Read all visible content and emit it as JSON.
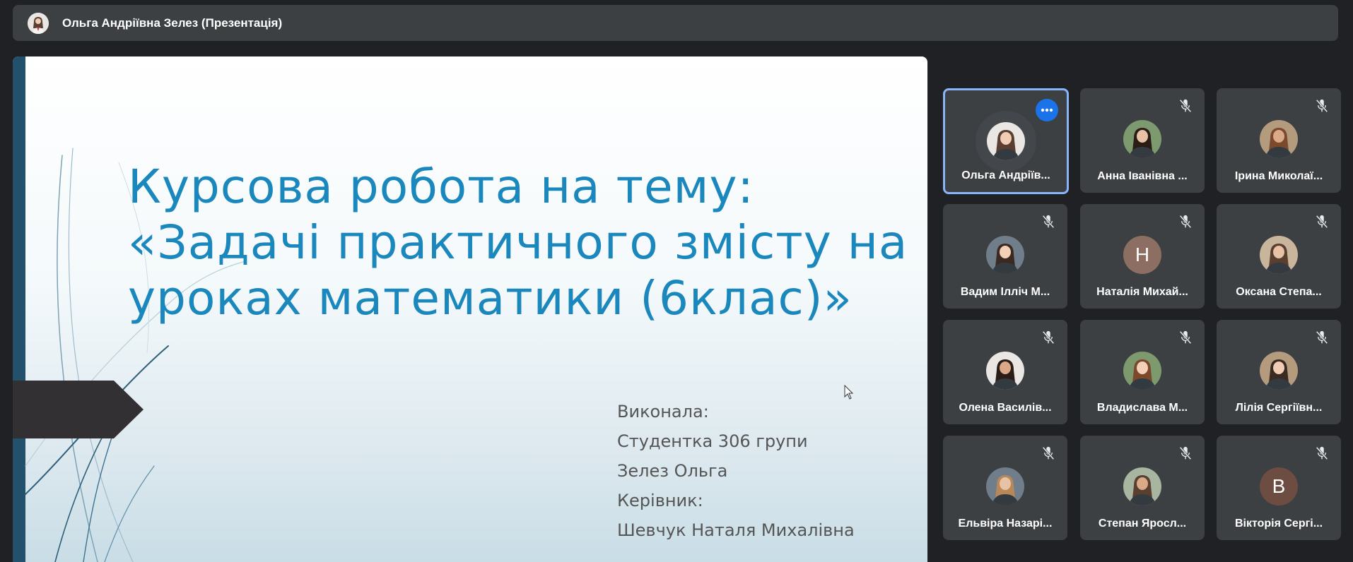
{
  "presenter_bar": {
    "title": "Ольга Андріївна Зелез (Презентація)",
    "avatar_icon": "user-avatar"
  },
  "slide": {
    "heading_lines": [
      "Курсова робота на тему:",
      "«Задачі практичного змісту на",
      "уроках математики (6клас)»"
    ],
    "author_lines": [
      "Виконала:",
      "Студентка 306 групи",
      "Зелез Ольга",
      "Керівник:",
      "Шевчук Наталя Михалівна"
    ],
    "accent_color": "#1a87bd"
  },
  "participants": [
    {
      "name": "Ольга Андріїв...",
      "avatar": "photo",
      "active": true,
      "muted": false,
      "icon": "more-options-icon"
    },
    {
      "name": "Анна Іванівна ...",
      "avatar": "photo",
      "muted": true,
      "icon": "mic-off-icon"
    },
    {
      "name": "Ірина Миколаї...",
      "avatar": "photo",
      "muted": true,
      "icon": "mic-off-icon"
    },
    {
      "name": "Вадим Ілліч М...",
      "avatar": "photo",
      "muted": true,
      "icon": "mic-off-icon"
    },
    {
      "name": "Наталія Михай...",
      "avatar": "letter",
      "letter": "Н",
      "color": "#8d6e63",
      "muted": true,
      "icon": "mic-off-icon"
    },
    {
      "name": "Оксана Степа...",
      "avatar": "photo",
      "muted": true,
      "icon": "mic-off-icon"
    },
    {
      "name": "Олена Василів...",
      "avatar": "photo",
      "muted": true,
      "icon": "mic-off-icon"
    },
    {
      "name": "Владислава М...",
      "avatar": "photo",
      "muted": true,
      "icon": "mic-off-icon"
    },
    {
      "name": "Лілія Сергіївн...",
      "avatar": "photo",
      "muted": true,
      "icon": "mic-off-icon"
    },
    {
      "name": "Ельвіра Назарі...",
      "avatar": "photo",
      "muted": true,
      "icon": "mic-off-icon"
    },
    {
      "name": "Степан Яросл...",
      "avatar": "photo",
      "muted": true,
      "icon": "mic-off-icon"
    },
    {
      "name": "Вікторія Сергі...",
      "avatar": "letter",
      "letter": "В",
      "color": "#6d4c41",
      "muted": true,
      "icon": "mic-off-icon"
    }
  ]
}
